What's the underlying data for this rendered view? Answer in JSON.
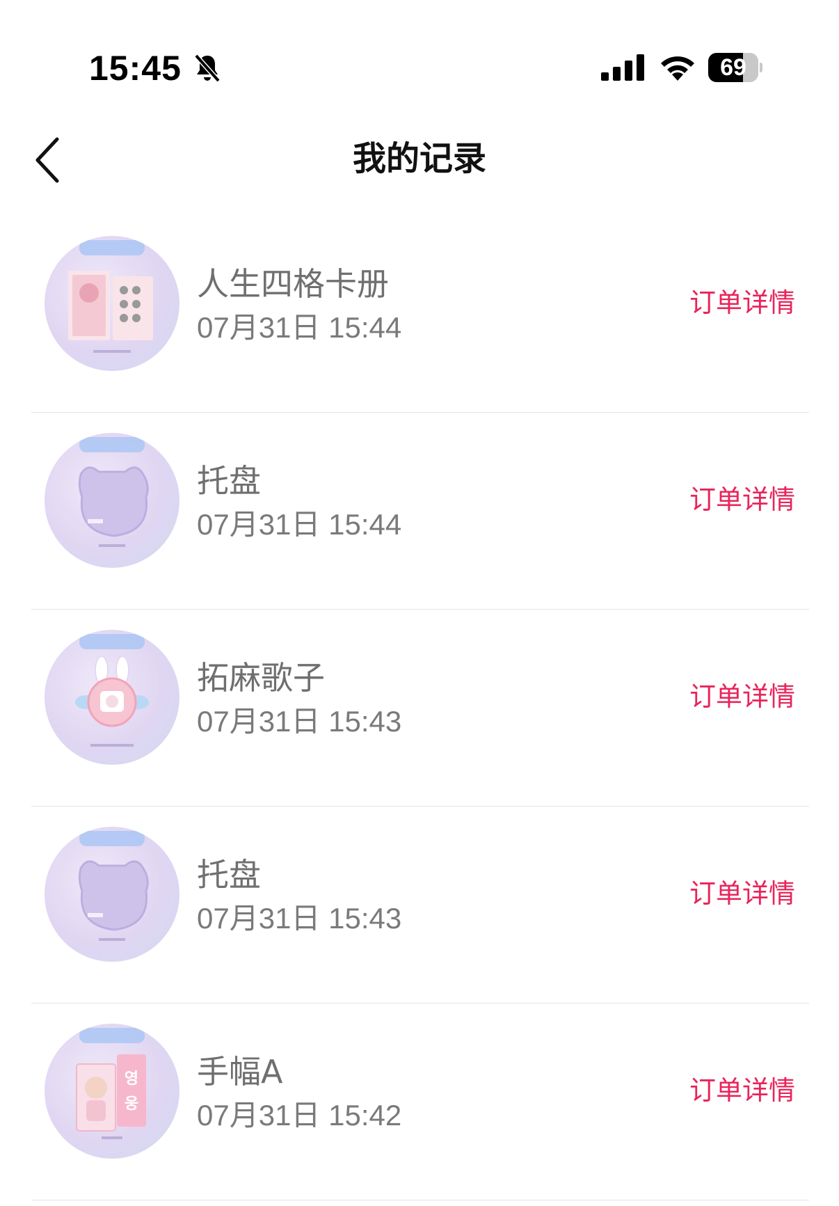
{
  "status_bar": {
    "time": "15:45",
    "battery_level": "69",
    "battery_fraction": 0.69,
    "icons": [
      "bell-off-icon",
      "signal-icon",
      "wifi-icon",
      "battery-icon"
    ]
  },
  "nav": {
    "back_icon": "chevron-left-icon",
    "title": "我的记录"
  },
  "colors": {
    "accent": "#e9245a",
    "name_text": "#6f6f6f",
    "time_text": "#7a7a7a",
    "divider": "#e4e4e4"
  },
  "records": [
    {
      "name": "人生四格卡册",
      "time": "07月31日 15:44",
      "action": "订单详情",
      "thumb_icon": "card-album-thumbnail"
    },
    {
      "name": "托盘",
      "time": "07月31日 15:44",
      "action": "订单详情",
      "thumb_icon": "tray-thumbnail"
    },
    {
      "name": "拓麻歌子",
      "time": "07月31日 15:43",
      "action": "订单详情",
      "thumb_icon": "tamagotchi-thumbnail"
    },
    {
      "name": "托盘",
      "time": "07月31日 15:43",
      "action": "订单详情",
      "thumb_icon": "tray-thumbnail"
    },
    {
      "name": "手幅A",
      "time": "07月31日 15:42",
      "action": "订单详情",
      "thumb_icon": "slogan-banner-thumbnail"
    }
  ]
}
